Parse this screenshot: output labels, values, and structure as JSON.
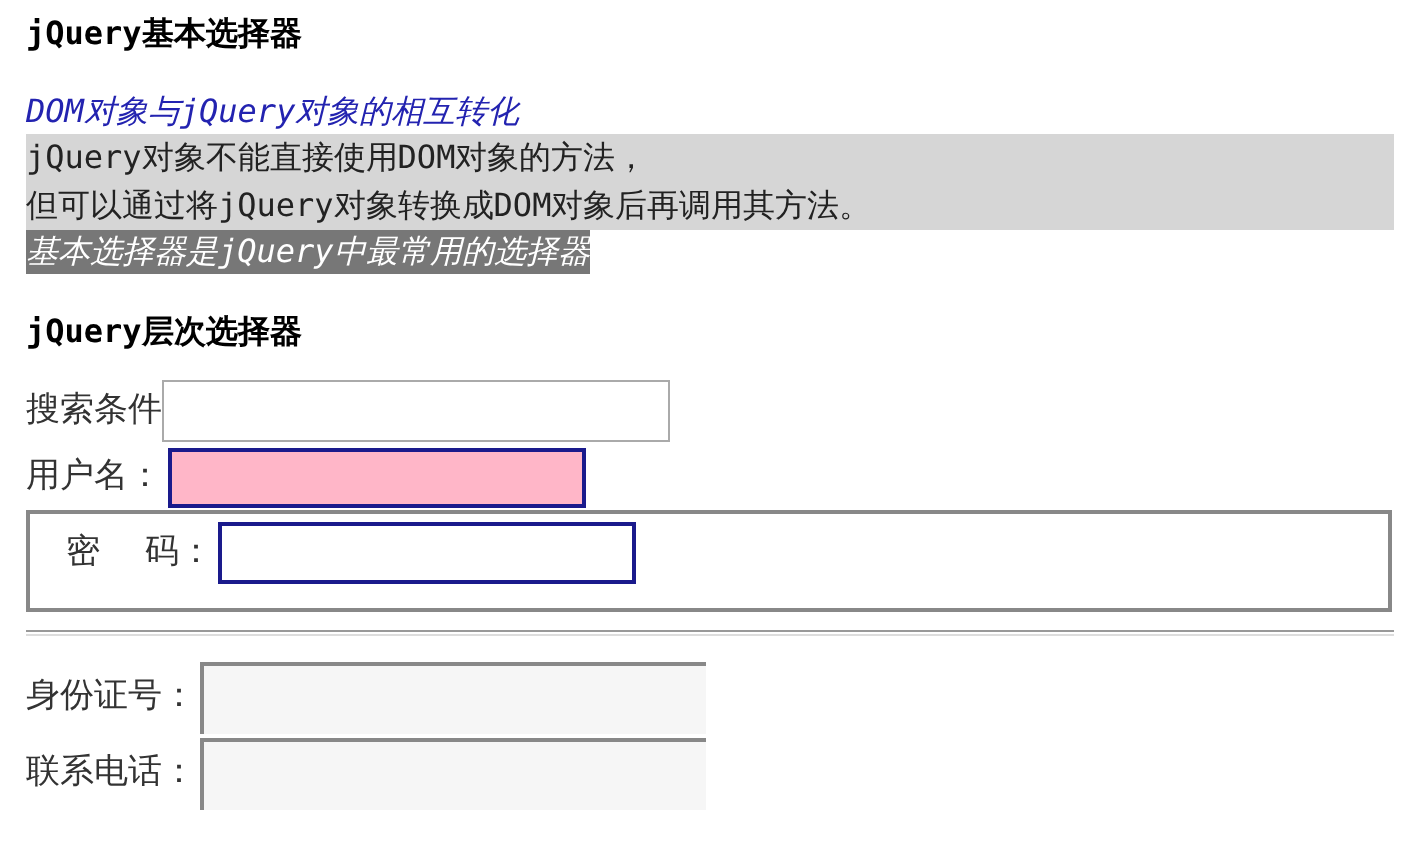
{
  "heading_basic": "jQuery基本选择器",
  "subtitle": "DOM对象与jQuery对象的相互转化",
  "note_lines": [
    "jQuery对象不能直接使用DOM对象的方法，",
    "但可以通过将jQuery对象转换成DOM对象后再调用其方法。"
  ],
  "highlight": "基本选择器是jQuery中最常用的选择器",
  "heading_hierarchy": "jQuery层次选择器",
  "fields_top": [
    {
      "label": "搜索条件",
      "kind": "plain"
    },
    {
      "label": "用户名：",
      "kind": "highlighted"
    }
  ],
  "fieldset": [
    {
      "label": "密　 码：",
      "kind": "outlined"
    }
  ],
  "fields_bottom": [
    {
      "label": "身份证号：",
      "kind": "inset"
    },
    {
      "label": "联系电话：",
      "kind": "inset"
    }
  ]
}
